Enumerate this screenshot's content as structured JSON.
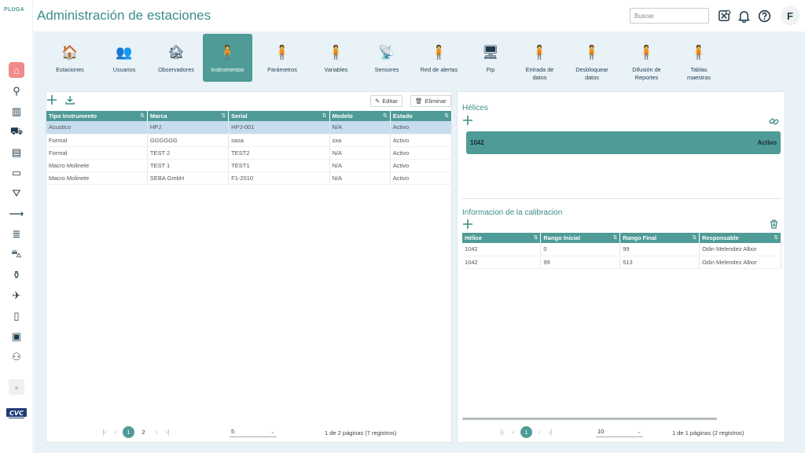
{
  "app": {
    "logo": "PLUGA",
    "title": "Administración de estaciones"
  },
  "header": {
    "search_placeholder": "Buscar",
    "user_initial": "F"
  },
  "sidebar": {
    "icons": [
      "home-icon",
      "pin-icon",
      "building-icon",
      "truck-icon",
      "server-icon",
      "rack-icon",
      "tap-icon",
      "wind-icon",
      "storage-icon",
      "car-icon",
      "bottle-icon",
      "plane-icon",
      "book-icon",
      "inbox-icon",
      "users-icon"
    ],
    "brand": "CVC"
  },
  "modules": [
    {
      "label": "Estaciones"
    },
    {
      "label": "Usuarios"
    },
    {
      "label": "Observadores"
    },
    {
      "label": "Instrumentos",
      "active": true
    },
    {
      "label": "Parámetros"
    },
    {
      "label": "Variables"
    },
    {
      "label": "Sensores"
    },
    {
      "label": "Red de alertas"
    },
    {
      "label": "Ftp"
    },
    {
      "label": "Entrada de datos"
    },
    {
      "label": "Desbloquear datos"
    },
    {
      "label": "Difusión de Reportes"
    },
    {
      "label": "Tablas maestras"
    }
  ],
  "instruments": {
    "edit_label": "Editar",
    "delete_label": "Eliminar",
    "columns": [
      "Tipo Instrumento",
      "Marca",
      "Serial",
      "Modelo",
      "Estado"
    ],
    "rows": [
      [
        "Acustico",
        "HPJ",
        "HPJ-001",
        "N/A",
        "Activo"
      ],
      [
        "Formal",
        "GGGGGG",
        "sasa",
        "sxa",
        "Activo"
      ],
      [
        "Formal",
        "TEST 2",
        "TEST2",
        "N/A",
        "Activo"
      ],
      [
        "Macro Molinete",
        "TEST 1",
        "TEST1",
        "N/A",
        "Activo"
      ],
      [
        "Macro Molinete",
        "SEBA GmbH",
        "F1-2010",
        "N/A",
        "Activo"
      ]
    ],
    "selected_row": 0,
    "pager": {
      "pages": [
        "1",
        "2"
      ],
      "current": "1",
      "page_size": "5",
      "info": "1 de 2 páginas (7 registros)"
    }
  },
  "helices": {
    "title": "Hélices",
    "item": {
      "id": "1042",
      "status": "Activo"
    }
  },
  "calibration": {
    "title": "Informacion de la calibracion",
    "columns": [
      "Hélice",
      "Rango Inicial",
      "Rango Final",
      "Responsable"
    ],
    "rows": [
      [
        "1042",
        "0",
        "99",
        "Odin Melendez Albor"
      ],
      [
        "1042",
        "99",
        "513",
        "Odin Melendez Albor"
      ]
    ],
    "pager": {
      "pages": [
        "1"
      ],
      "current": "1",
      "page_size": "10",
      "info": "1 de 1 páginas (2 registros)"
    }
  },
  "colors": {
    "accent": "#4f9b97",
    "title": "#3c8d88",
    "selection": "#c7dcef",
    "active_sidebar": "#f08a8a"
  }
}
